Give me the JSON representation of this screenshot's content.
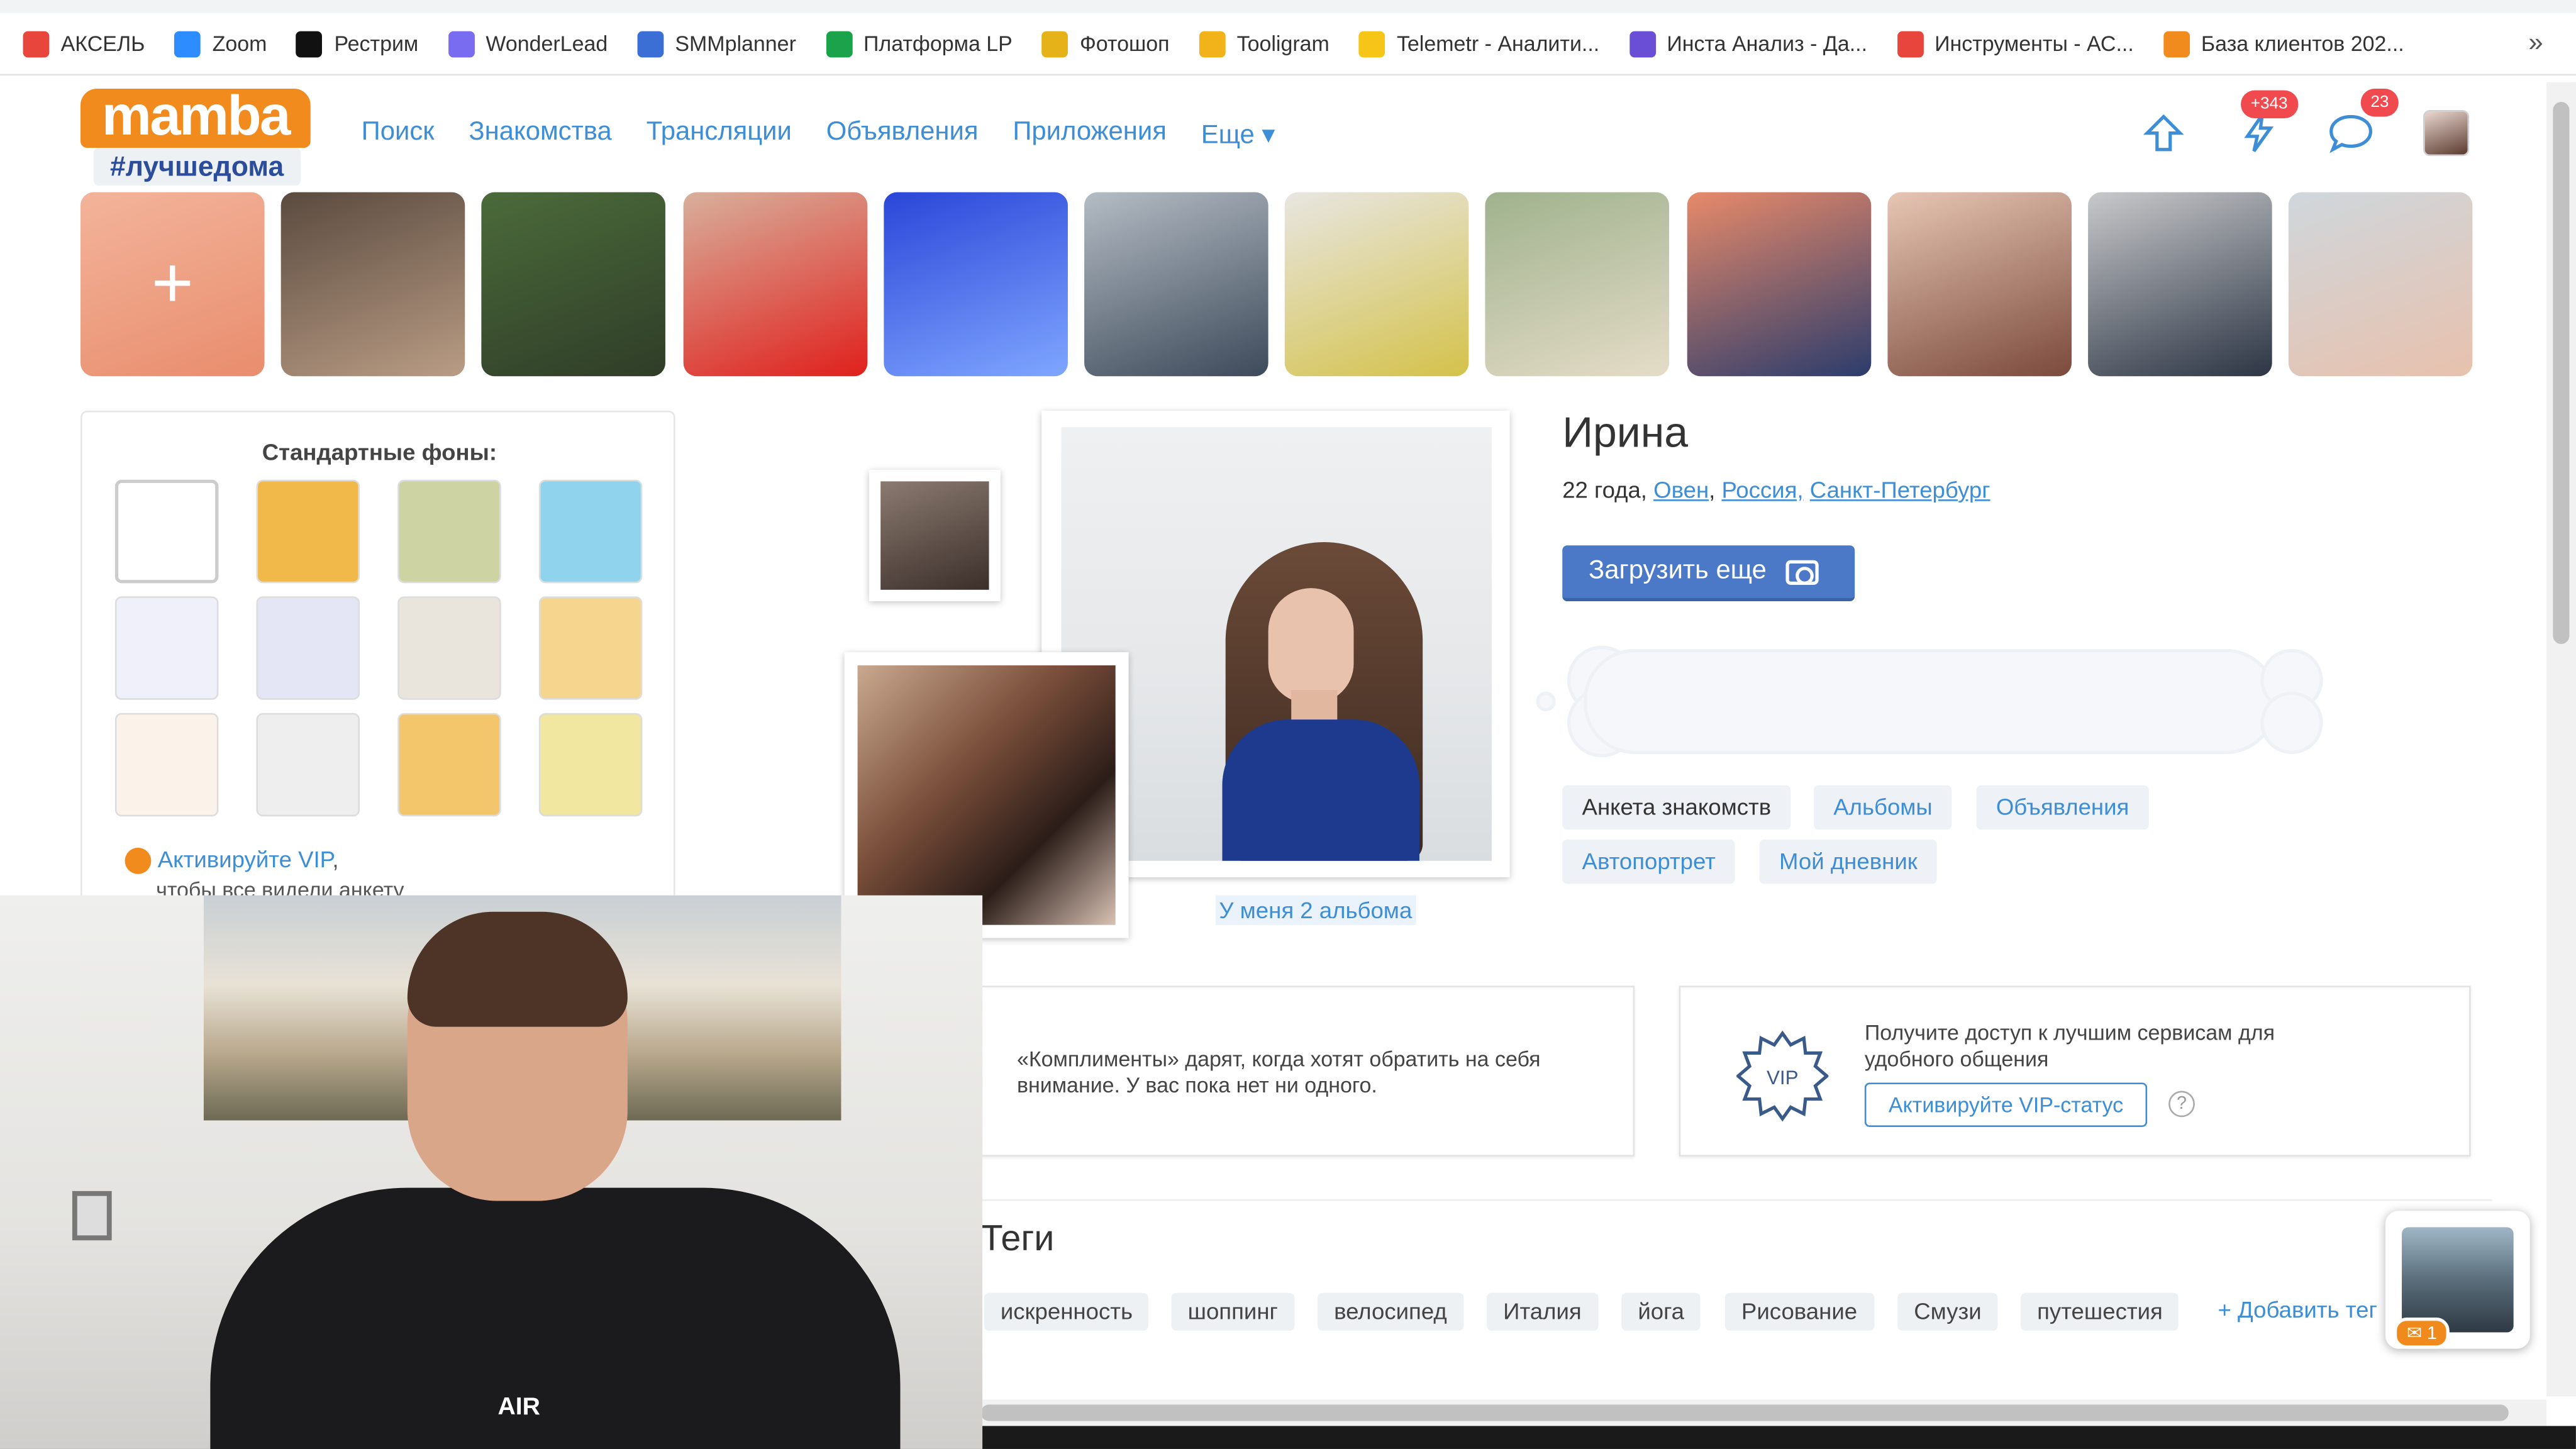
{
  "bookmarks": [
    {
      "label": "АКСЕЛЬ",
      "icon": "warning-triangle-icon",
      "color": "#e8453c"
    },
    {
      "label": "Zoom",
      "icon": "zoom-icon",
      "color": "#2d8cff"
    },
    {
      "label": "Рестрим",
      "icon": "restream-icon",
      "color": "#111111"
    },
    {
      "label": "WonderLead",
      "icon": "wonderlead-icon",
      "color": "#7a6cf0"
    },
    {
      "label": "SMMplanner",
      "icon": "paper-plane-icon",
      "color": "#3b6fd6"
    },
    {
      "label": "Платформа LP",
      "icon": "bars-icon",
      "color": "#1aa34a"
    },
    {
      "label": "Фотошоп",
      "icon": "brush-icon",
      "color": "#e6b21a"
    },
    {
      "label": "Tooligram",
      "icon": "tooligram-icon",
      "color": "#f2b21a"
    },
    {
      "label": "Telemetr - Аналити...",
      "icon": "telemetr-icon",
      "color": "#f5c518"
    },
    {
      "label": "Инста Анализ - Да...",
      "icon": "insta-analysis-icon",
      "color": "#6a4ed6"
    },
    {
      "label": "Инструменты - АС...",
      "icon": "warning-triangle-icon",
      "color": "#e8453c"
    },
    {
      "label": "База клиентов 202...",
      "icon": "database-icon",
      "color": "#f28b1e"
    }
  ],
  "bookmarks_more": "»",
  "logo": {
    "word": "mamba",
    "tag": "#лучшедома"
  },
  "nav": [
    "Поиск",
    "Знакомства",
    "Трансляции",
    "Объявления",
    "Приложения",
    "Еще ▾"
  ],
  "header_badges": {
    "lightning": "+343",
    "messages": "23"
  },
  "stories": [
    {
      "icon": "plus-icon",
      "colors": [
        "#f3b49b",
        "#e98d6d"
      ]
    },
    {
      "colors": [
        "#5a4a3f",
        "#b99c84"
      ]
    },
    {
      "colors": [
        "#4b6b3a",
        "#2f3d28"
      ]
    },
    {
      "colors": [
        "#d8b09c",
        "#e0201c"
      ]
    },
    {
      "colors": [
        "#2a46d8",
        "#7fa6ff"
      ]
    },
    {
      "colors": [
        "#b4bcc4",
        "#3d4a5a"
      ]
    },
    {
      "colors": [
        "#e8e6e2",
        "#d4c24a"
      ]
    },
    {
      "colors": [
        "#9fb28d",
        "#e5dcc8"
      ]
    },
    {
      "colors": [
        "#e88a6a",
        "#2b3c6c"
      ]
    },
    {
      "colors": [
        "#e7c6b4",
        "#7b4a3c"
      ]
    },
    {
      "colors": [
        "#c8c9cb",
        "#2c3544"
      ]
    },
    {
      "colors": [
        "#cfd7dc",
        "#e8c1ad"
      ]
    }
  ],
  "backgrounds": {
    "title": "Стандартные фоны:",
    "swatches": [
      "#ffffff",
      "#f0b94a",
      "#cdd3a2",
      "#8fd4ec",
      "#f0f0fa",
      "#e4e6f5",
      "#e9e4dc",
      "#f6d58f",
      "#fbf3ea",
      "#eeeeee",
      "#f3c66c",
      "#f1e7a1"
    ],
    "vip_link": "Активируйте VIP",
    "vip_comma": ",",
    "vip_sub": "чтобы все видели анкету"
  },
  "profile": {
    "name": "Ирина",
    "age": "22 года,",
    "sign": "Овен",
    "country": "Россия,",
    "city": "Санкт-Петербург",
    "upload_label": "Загрузить еще",
    "albums_link": "У меня 2 альбома"
  },
  "tabs": [
    "Анкета знакомств",
    "Альбомы",
    "Объявления",
    "Автопортрет",
    "Мой дневник"
  ],
  "compliments": {
    "text": "«Комплименты» дарят, когда хотят обратить на себя внимание. У вас пока нет ни одного."
  },
  "vip": {
    "star_label": "VIP",
    "text": "Получите доступ к лучшим сервисам для удобного общения",
    "button": "Активируйте VIP-статус",
    "help": "?"
  },
  "tags": {
    "title": "Теги",
    "items": [
      "искренность",
      "шоппинг",
      "велосипед",
      "Италия",
      "йога",
      "Рисование",
      "Смузи",
      "путешестия"
    ],
    "add": "+ Добавить тег"
  },
  "float_badge": "1",
  "webcam": {
    "shirt_text": "AIR"
  }
}
